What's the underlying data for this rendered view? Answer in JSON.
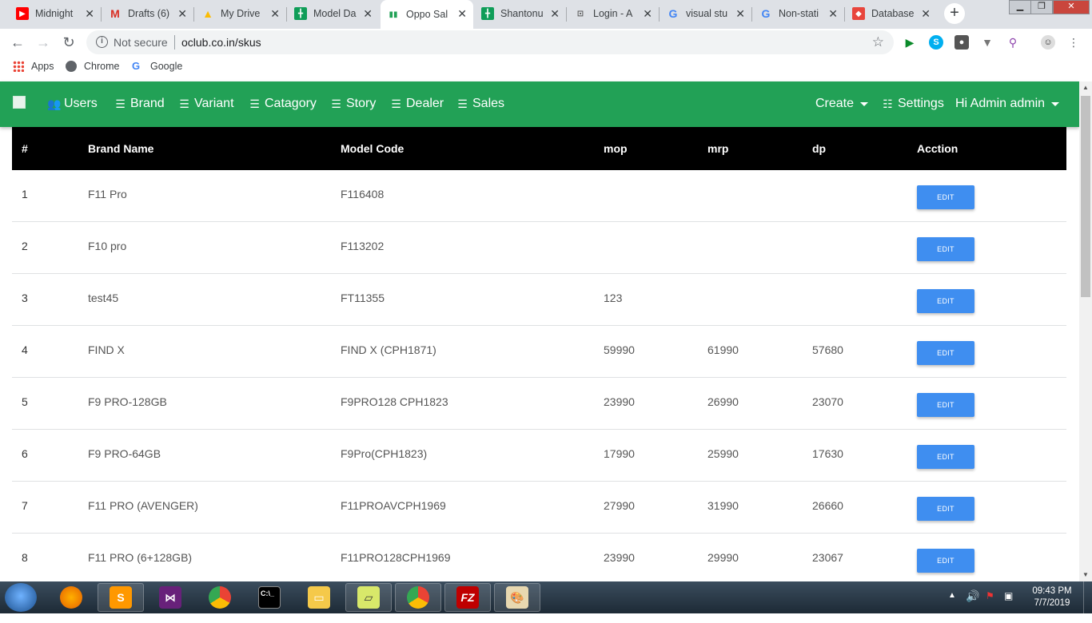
{
  "browser": {
    "tabs": [
      {
        "title": "Midnight",
        "icon": "youtube-icon"
      },
      {
        "title": "Drafts (6)",
        "icon": "gmail-icon"
      },
      {
        "title": "My Drive",
        "icon": "drive-icon"
      },
      {
        "title": "Model Da",
        "icon": "sheets-icon"
      },
      {
        "title": "Oppo Sal",
        "icon": "chart-icon"
      },
      {
        "title": "Shantonu",
        "icon": "sheets-icon"
      },
      {
        "title": "Login - A",
        "icon": "login-icon"
      },
      {
        "title": "visual stu",
        "icon": "google-icon"
      },
      {
        "title": "Non-stati",
        "icon": "google-icon"
      },
      {
        "title": "Database",
        "icon": "database-icon"
      }
    ],
    "security_label": "Not secure",
    "url": "oclub.co.in/skus",
    "bookmarks": [
      "Apps",
      "Chrome",
      "Google"
    ]
  },
  "navbar": {
    "items": [
      "Users",
      "Brand",
      "Variant",
      "Catagory",
      "Story",
      "Dealer",
      "Sales"
    ],
    "create_label": "Create",
    "settings_label": "Settings",
    "user_label": "Hi Admin admin"
  },
  "table": {
    "headers": [
      "#",
      "Brand Name",
      "Model Code",
      "mop",
      "mrp",
      "dp",
      "Acction"
    ],
    "edit_label": "EDIT",
    "rows": [
      {
        "id": "1",
        "brand": "F11 Pro",
        "model": "F116408",
        "mop": "",
        "mrp": "",
        "dp": ""
      },
      {
        "id": "2",
        "brand": "F10 pro",
        "model": "F113202",
        "mop": "",
        "mrp": "",
        "dp": ""
      },
      {
        "id": "3",
        "brand": "test45",
        "model": "FT11355",
        "mop": "123",
        "mrp": "",
        "dp": ""
      },
      {
        "id": "4",
        "brand": "FIND X",
        "model": "FIND X (CPH1871)",
        "mop": "59990",
        "mrp": "61990",
        "dp": "57680"
      },
      {
        "id": "5",
        "brand": "F9 PRO-128GB",
        "model": "F9PRO128 CPH1823",
        "mop": "23990",
        "mrp": "26990",
        "dp": "23070"
      },
      {
        "id": "6",
        "brand": "F9 PRO-64GB",
        "model": "F9Pro(CPH1823)",
        "mop": "17990",
        "mrp": "25990",
        "dp": "17630"
      },
      {
        "id": "7",
        "brand": "F11 PRO (AVENGER)",
        "model": "F11PROAVCPH1969",
        "mop": "27990",
        "mrp": "31990",
        "dp": "26660"
      },
      {
        "id": "8",
        "brand": "F11 PRO (6+128GB)",
        "model": "F11PRO128CPH1969",
        "mop": "23990",
        "mrp": "29990",
        "dp": "23067"
      }
    ]
  },
  "taskbar": {
    "time": "09:43 PM",
    "date": "7/7/2019"
  },
  "colors": {
    "navbar": "#22a156",
    "edit_button": "#3f8ef0",
    "table_header": "#000000"
  }
}
